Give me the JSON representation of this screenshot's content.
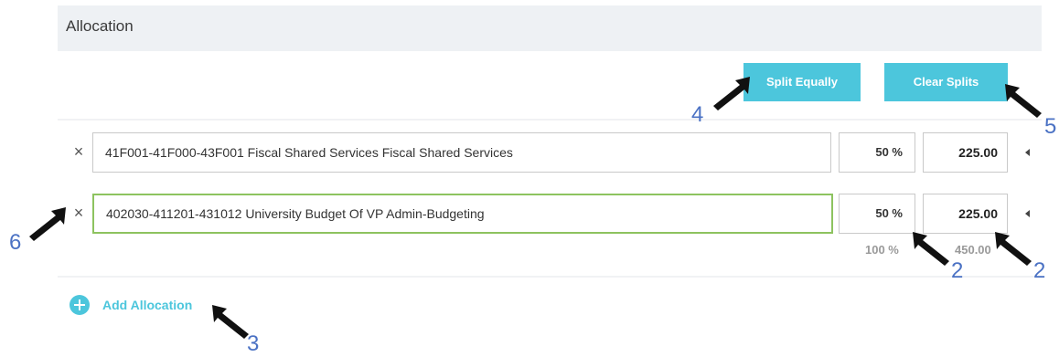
{
  "section": {
    "title": "Allocation"
  },
  "toolbar": {
    "split_label": "Split Equally",
    "clear_label": "Clear Splits"
  },
  "allocations": [
    {
      "remove_glyph": "×",
      "account": "41F001-41F000-43F001 Fiscal Shared Services Fiscal Shared Services",
      "percent": "50 %",
      "amount": "225.00"
    },
    {
      "remove_glyph": "×",
      "account": "402030-411201-431012 University Budget Of VP Admin-Budgeting",
      "percent": "50 %",
      "amount": "225.00"
    }
  ],
  "totals": {
    "percent": "100 %",
    "amount": "450.00"
  },
  "add": {
    "label": "Add Allocation"
  },
  "annotations": {
    "split_num": "4",
    "clear_num": "5",
    "remove_num": "6",
    "pct_num": "2",
    "amt_num": "2",
    "add_num": "3"
  },
  "colors": {
    "accent": "#4cc6dc",
    "active_border": "#8dc35f",
    "annotation": "#4b72c4",
    "header_bg": "#eef1f4"
  },
  "icons": {
    "remove": "close-icon",
    "add": "plus-circle-icon",
    "row_toggle": "caret-left-icon",
    "pointer": "arrow-pointer-icon"
  }
}
